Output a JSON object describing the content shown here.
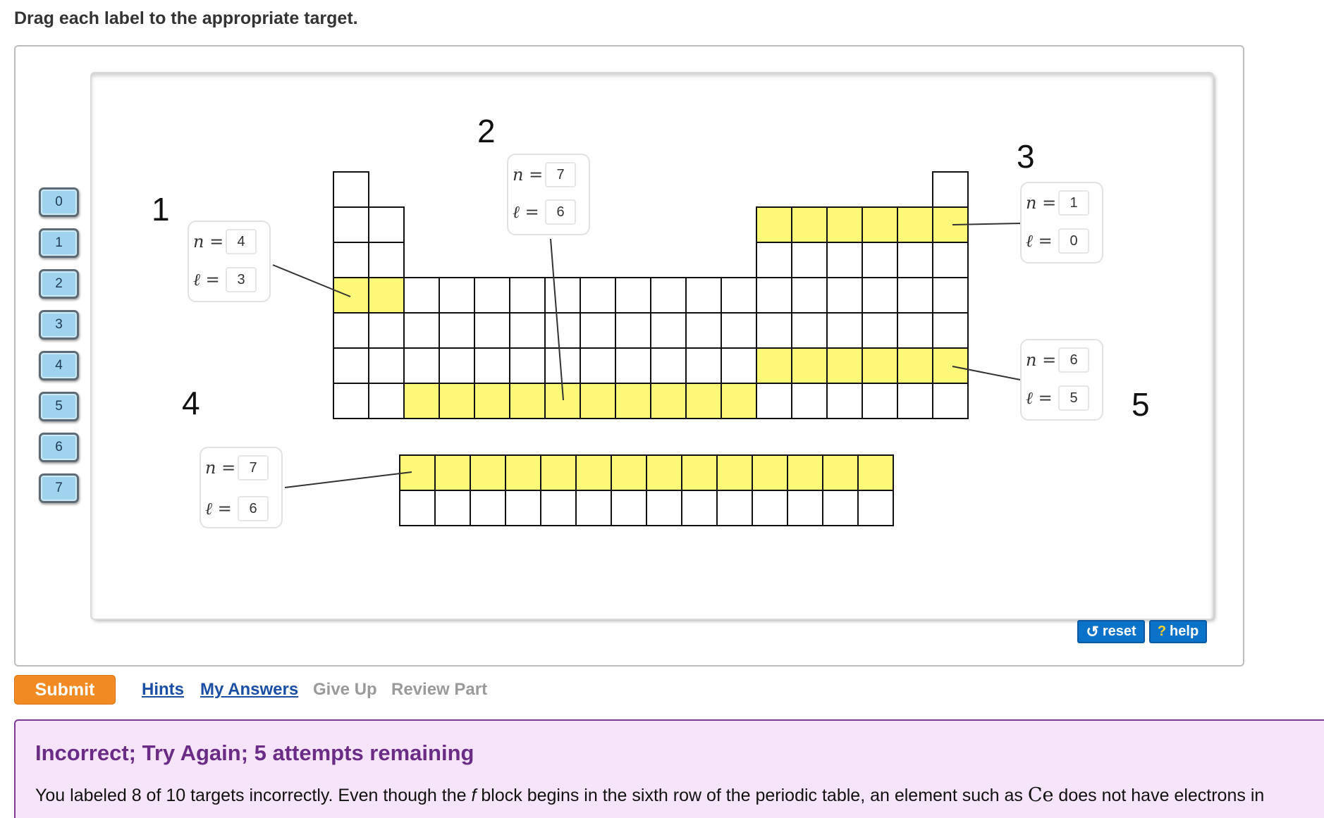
{
  "instruction": "Drag each label to the appropriate target.",
  "tokens": [
    "0",
    "1",
    "2",
    "3",
    "4",
    "5",
    "6",
    "7"
  ],
  "target_numbers": [
    "1",
    "2",
    "3",
    "4",
    "5"
  ],
  "targets": [
    {
      "n": "4",
      "l": "3"
    },
    {
      "n": "7",
      "l": "6"
    },
    {
      "n": "1",
      "l": "0"
    },
    {
      "n": "7",
      "l": "6"
    },
    {
      "n": "6",
      "l": "5"
    }
  ],
  "quantum_labels": {
    "n": "n =",
    "l": "ℓ ="
  },
  "highlight_color": "#fcf979",
  "buttons": {
    "reset": "reset",
    "reset_icon": "↺",
    "help": "help",
    "help_icon": "?",
    "submit": "Submit"
  },
  "links": {
    "hints": "Hints",
    "my_answers": "My Answers",
    "give_up": "Give Up",
    "review_part": "Review Part"
  },
  "feedback": {
    "title": "Incorrect; Try Again; 5 attempts remaining",
    "text_before": "You labeled 8 of 10 targets incorrectly. Even though the ",
    "italic": "f",
    "text_middle": " block begins in the sixth row of the periodic table, an element such as ",
    "element": "Ce",
    "text_after": " does not have electrons in"
  }
}
